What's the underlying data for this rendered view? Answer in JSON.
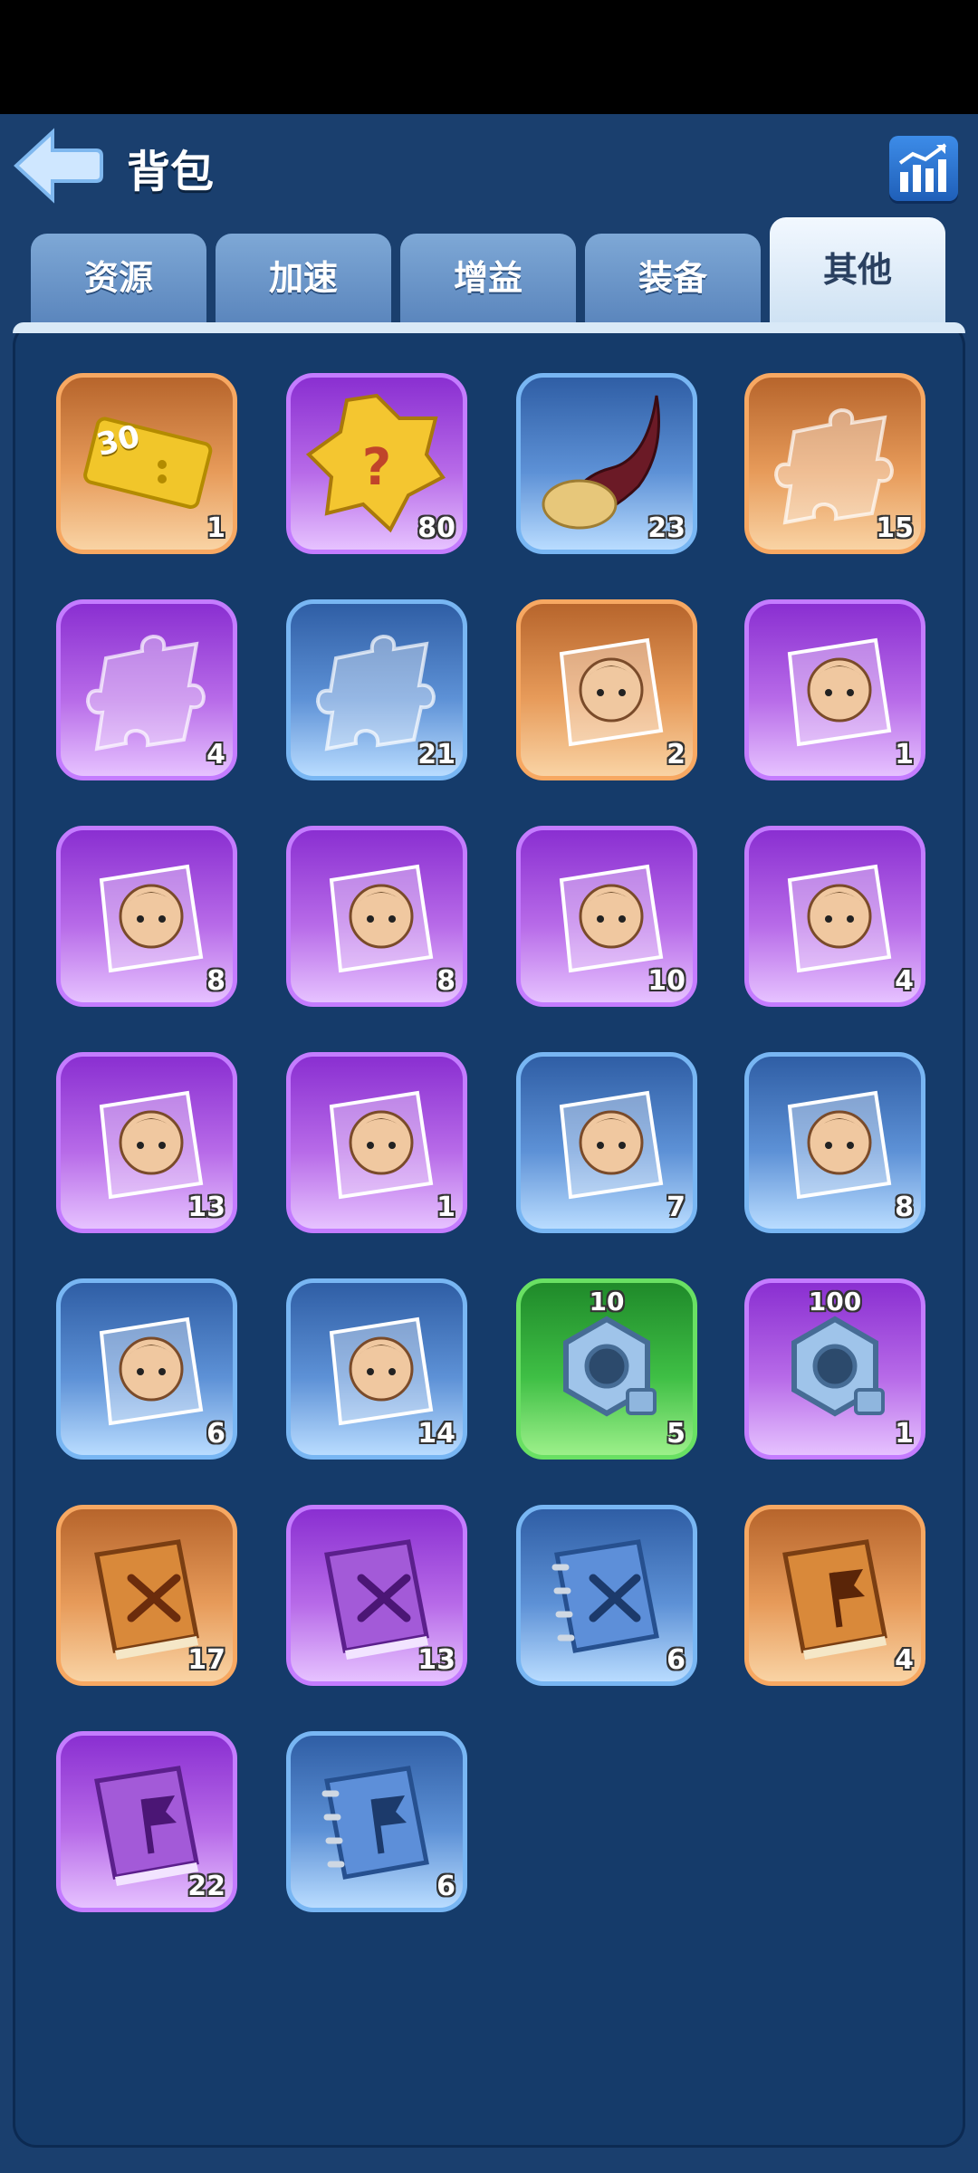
{
  "header": {
    "title": "背包"
  },
  "tabs": [
    {
      "label": "资源"
    },
    {
      "label": "加速"
    },
    {
      "label": "增益"
    },
    {
      "label": "装备"
    },
    {
      "label": "其他",
      "active": true
    }
  ],
  "items": [
    {
      "icon": "ticket-icon",
      "ticket_text": "30",
      "count": "1",
      "rarity": "orange"
    },
    {
      "icon": "mystery-box-icon",
      "count": "80",
      "rarity": "purple"
    },
    {
      "icon": "horn-icon",
      "count": "23",
      "rarity": "blue"
    },
    {
      "icon": "puzzle-piece-icon",
      "count": "15",
      "rarity": "orange"
    },
    {
      "icon": "puzzle-piece-icon",
      "count": "4",
      "rarity": "purple"
    },
    {
      "icon": "puzzle-piece-icon",
      "count": "21",
      "rarity": "blue"
    },
    {
      "icon": "hero-fragment-icon",
      "count": "2",
      "rarity": "orange"
    },
    {
      "icon": "hero-fragment-icon",
      "count": "1",
      "rarity": "purple"
    },
    {
      "icon": "hero-fragment-icon",
      "count": "8",
      "rarity": "purple"
    },
    {
      "icon": "hero-fragment-icon",
      "count": "8",
      "rarity": "purple"
    },
    {
      "icon": "hero-fragment-icon",
      "count": "10",
      "rarity": "purple"
    },
    {
      "icon": "hero-fragment-icon",
      "count": "4",
      "rarity": "purple"
    },
    {
      "icon": "hero-fragment-icon",
      "count": "13",
      "rarity": "purple"
    },
    {
      "icon": "hero-fragment-icon",
      "count": "1",
      "rarity": "purple"
    },
    {
      "icon": "hero-fragment-icon",
      "count": "7",
      "rarity": "blue"
    },
    {
      "icon": "hero-fragment-icon",
      "count": "8",
      "rarity": "blue"
    },
    {
      "icon": "hero-fragment-icon",
      "count": "6",
      "rarity": "blue"
    },
    {
      "icon": "hero-fragment-icon",
      "count": "14",
      "rarity": "blue"
    },
    {
      "icon": "hex-nut-icon",
      "top_label": "10",
      "count": "5",
      "rarity": "green"
    },
    {
      "icon": "hex-nut-icon",
      "top_label": "100",
      "count": "1",
      "rarity": "purple"
    },
    {
      "icon": "sword-book-icon",
      "count": "17",
      "rarity": "orange"
    },
    {
      "icon": "sword-book-icon",
      "count": "13",
      "rarity": "purple"
    },
    {
      "icon": "sword-notebook-icon",
      "count": "6",
      "rarity": "blue"
    },
    {
      "icon": "flag-book-icon",
      "count": "4",
      "rarity": "orange"
    },
    {
      "icon": "flag-book-icon",
      "count": "22",
      "rarity": "purple"
    },
    {
      "icon": "flag-notebook-icon",
      "count": "6",
      "rarity": "blue"
    }
  ]
}
